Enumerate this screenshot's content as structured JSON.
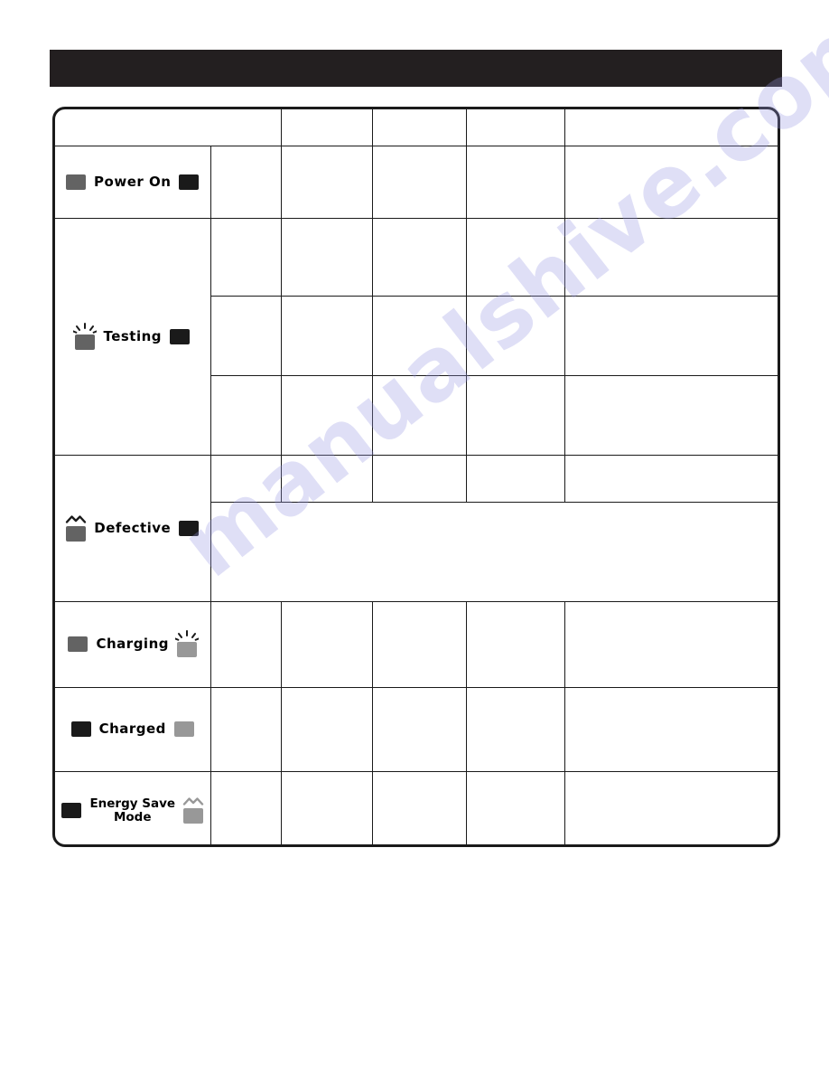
{
  "page": {
    "watermark": "manualshive.com",
    "background_color": "#ffffff"
  },
  "header": {
    "title": "",
    "background_color": "#231f20",
    "text_color": "#ffffff"
  },
  "legend": {
    "colors": {
      "led_off_or_solid_black": "#1a1a1a",
      "led_gray_mid": "#636363",
      "led_gray_light": "#989898",
      "border": "#1a1a1a"
    },
    "marks": {
      "flash": "flashing-rays",
      "slow_blink": "wavy-tilde"
    }
  },
  "table": {
    "columns": [
      {
        "key": "status",
        "header": ""
      },
      {
        "key": "col2",
        "header": ""
      },
      {
        "key": "col3",
        "header": ""
      },
      {
        "key": "col4",
        "header": ""
      },
      {
        "key": "col5",
        "header": ""
      },
      {
        "key": "col6",
        "header": ""
      }
    ],
    "header_row": {
      "label_cell": "",
      "cells": [
        "",
        "",
        "",
        ""
      ]
    },
    "rows": [
      {
        "id": "power-on",
        "label": "Power On",
        "left_led": {
          "state": "gray-mid",
          "mark": "none"
        },
        "right_led": {
          "state": "on-dark",
          "mark": "none"
        },
        "label_lines": 1,
        "subrows": [
          {
            "cells": [
              "",
              "",
              "",
              "",
              ""
            ]
          }
        ]
      },
      {
        "id": "testing",
        "label": "Testing",
        "left_led": {
          "state": "gray-mid",
          "mark": "flash"
        },
        "right_led": {
          "state": "on-dark",
          "mark": "none"
        },
        "label_lines": 1,
        "subrows": [
          {
            "cells": [
              "",
              "",
              "",
              "",
              ""
            ]
          },
          {
            "cells": [
              "",
              "",
              "",
              "",
              ""
            ]
          },
          {
            "cells": [
              "",
              "",
              "",
              "",
              ""
            ]
          }
        ]
      },
      {
        "id": "defective",
        "label": "Defective",
        "left_led": {
          "state": "gray-mid",
          "mark": "slow_blink"
        },
        "right_led": {
          "state": "on-dark",
          "mark": "none"
        },
        "label_lines": 1,
        "subrows": [
          {
            "cells": [
              "",
              "",
              "",
              "",
              ""
            ]
          },
          {
            "merged_full_width": true,
            "text": ""
          }
        ]
      },
      {
        "id": "charging",
        "label": "Charging",
        "left_led": {
          "state": "gray-mid",
          "mark": "none"
        },
        "right_led": {
          "state": "gray-lite",
          "mark": "flash"
        },
        "label_lines": 1,
        "subrows": [
          {
            "cells": [
              "",
              "",
              "",
              "",
              ""
            ]
          }
        ]
      },
      {
        "id": "charged",
        "label": "Charged",
        "left_led": {
          "state": "on-dark",
          "mark": "none"
        },
        "right_led": {
          "state": "gray-lite",
          "mark": "none"
        },
        "label_lines": 1,
        "subrows": [
          {
            "cells": [
              "",
              "",
              "",
              "",
              ""
            ]
          }
        ]
      },
      {
        "id": "energy-save-mode",
        "label": "Energy Save\nMode",
        "left_led": {
          "state": "on-dark",
          "mark": "none"
        },
        "right_led": {
          "state": "gray-lite",
          "mark": "slow_blink"
        },
        "label_lines": 2,
        "subrows": [
          {
            "cells": [
              "",
              "",
              "",
              "",
              ""
            ]
          }
        ]
      }
    ]
  }
}
